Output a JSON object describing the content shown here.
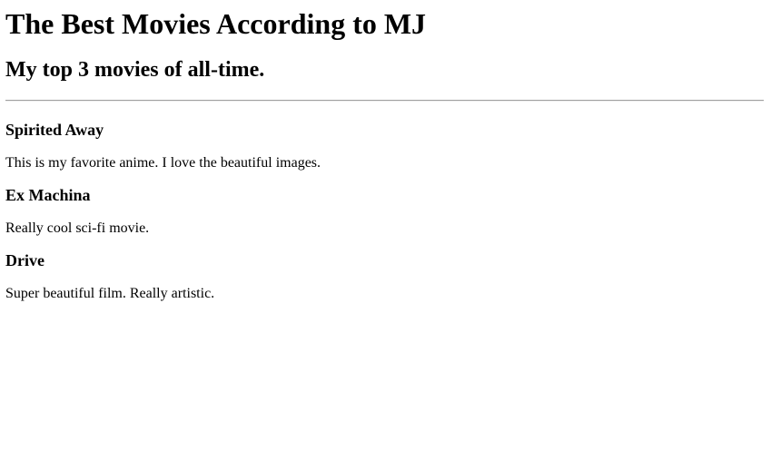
{
  "header": {
    "title": "The Best Movies According to MJ",
    "subtitle": "My top 3 movies of all-time."
  },
  "movies": [
    {
      "title": "Spirited Away",
      "description": "This is my favorite anime. I love the beautiful images."
    },
    {
      "title": "Ex Machina",
      "description": "Really cool sci-fi movie."
    },
    {
      "title": "Drive",
      "description": "Super beautiful film. Really artistic."
    }
  ]
}
